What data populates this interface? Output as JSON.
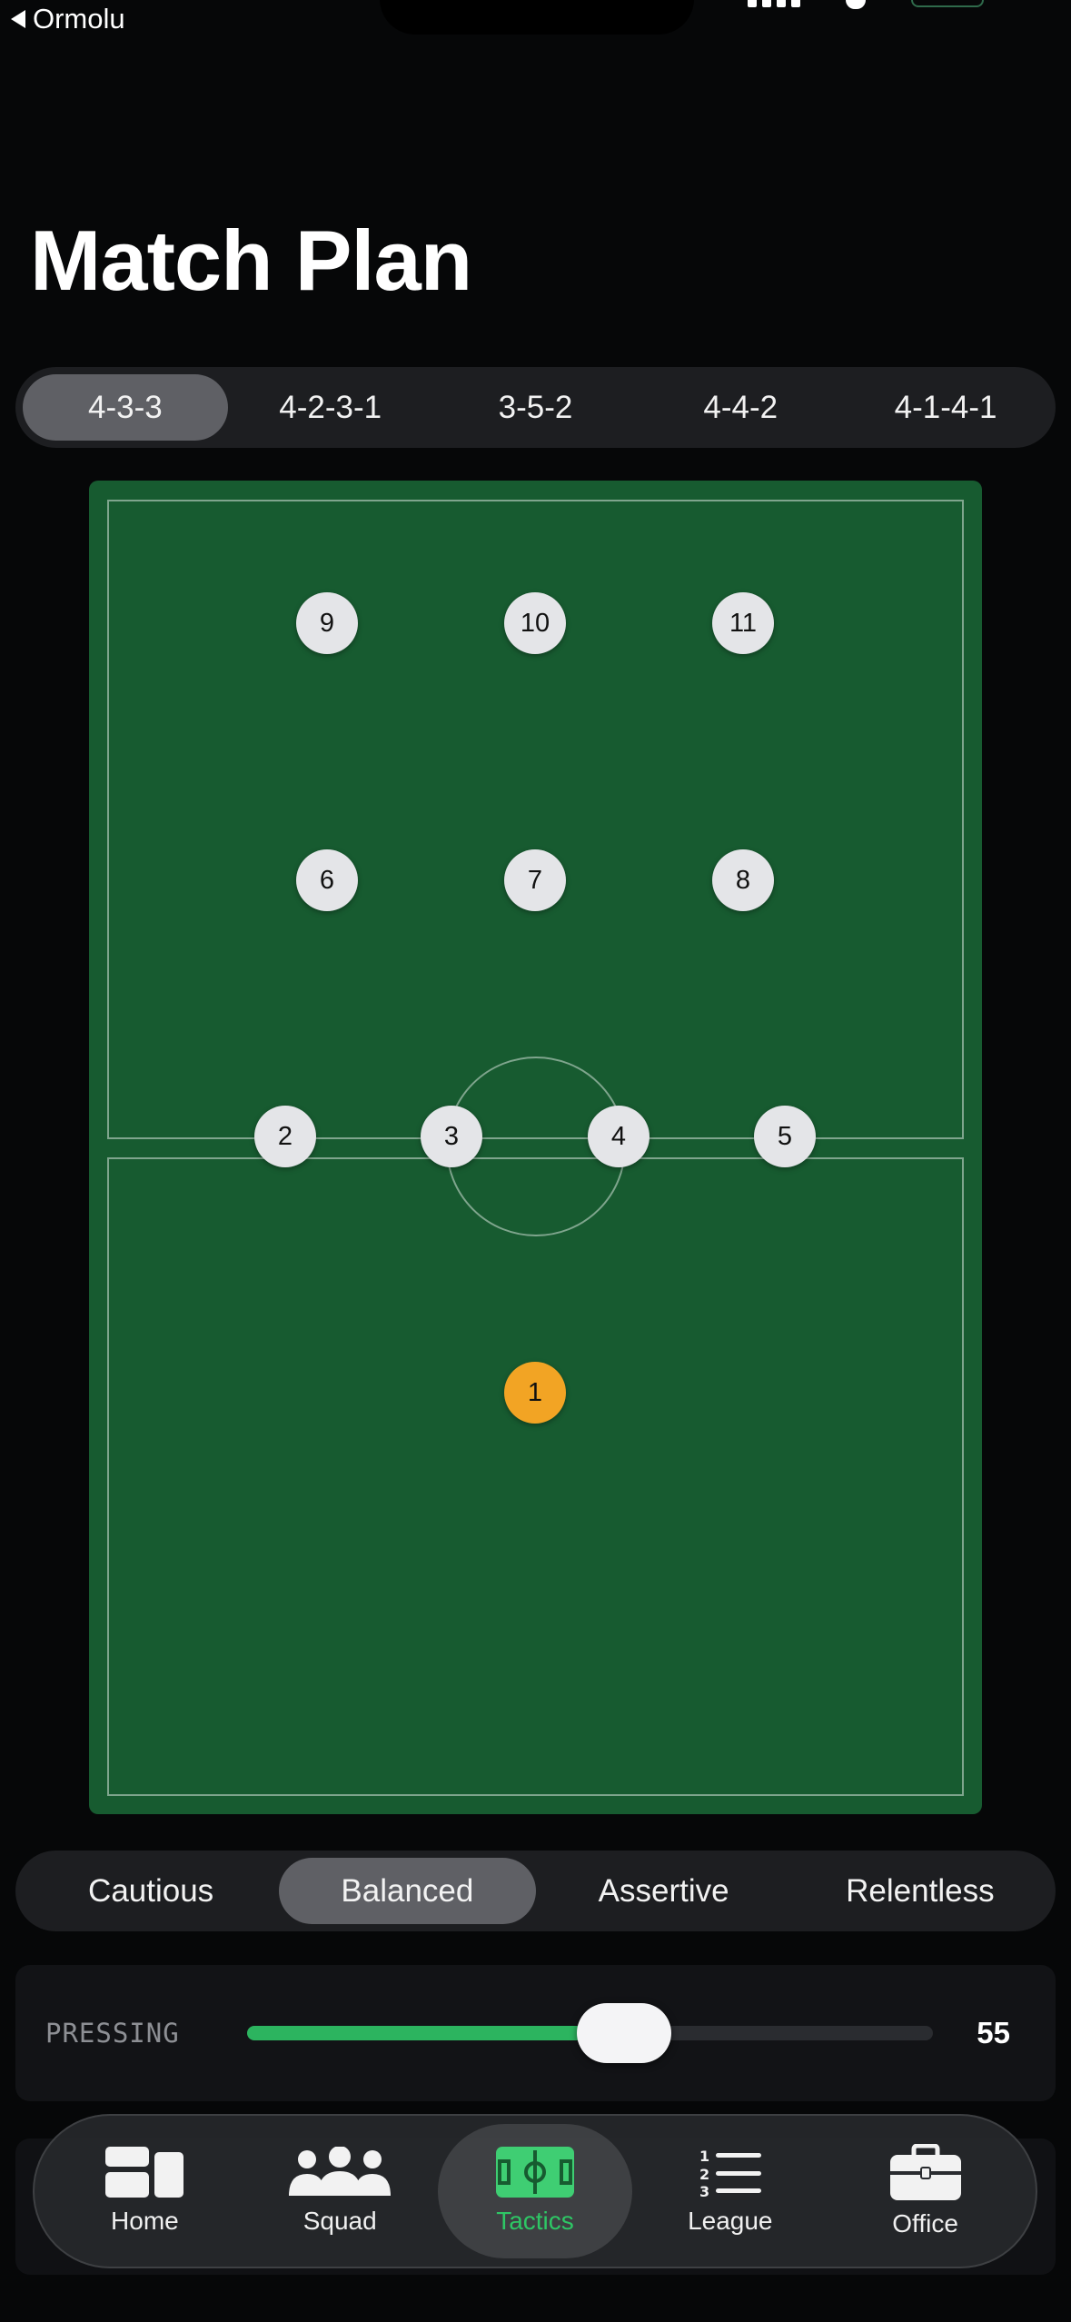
{
  "status_bar": {
    "back_label": "Ormolu"
  },
  "page": {
    "title": "Match Plan"
  },
  "formations": {
    "options": [
      "4-3-3",
      "4-2-3-1",
      "3-5-2",
      "4-4-2",
      "4-1-4-1"
    ],
    "selected": "4-3-3"
  },
  "pitch": {
    "players": [
      "1",
      "2",
      "3",
      "4",
      "5",
      "6",
      "7",
      "8",
      "9",
      "10",
      "11"
    ],
    "goalkeeper": "1"
  },
  "mentality": {
    "options": [
      "Cautious",
      "Balanced",
      "Assertive",
      "Relentless"
    ],
    "selected": "Balanced"
  },
  "pressing": {
    "label": "PRESSING",
    "value": "55",
    "fraction": 0.55
  },
  "tabbar": {
    "items": [
      {
        "label": "Home",
        "icon": "home-grid-icon"
      },
      {
        "label": "Squad",
        "icon": "people-icon"
      },
      {
        "label": "Tactics",
        "icon": "pitch-icon"
      },
      {
        "label": "League",
        "icon": "numbered-list-icon"
      },
      {
        "label": "Office",
        "icon": "briefcase-icon"
      }
    ],
    "selected": "Tactics"
  },
  "colors": {
    "accent": "#2ec665",
    "pitch": "#175b30",
    "goalkeeper": "#f2a424",
    "slider_fill": "#2cb45f"
  }
}
